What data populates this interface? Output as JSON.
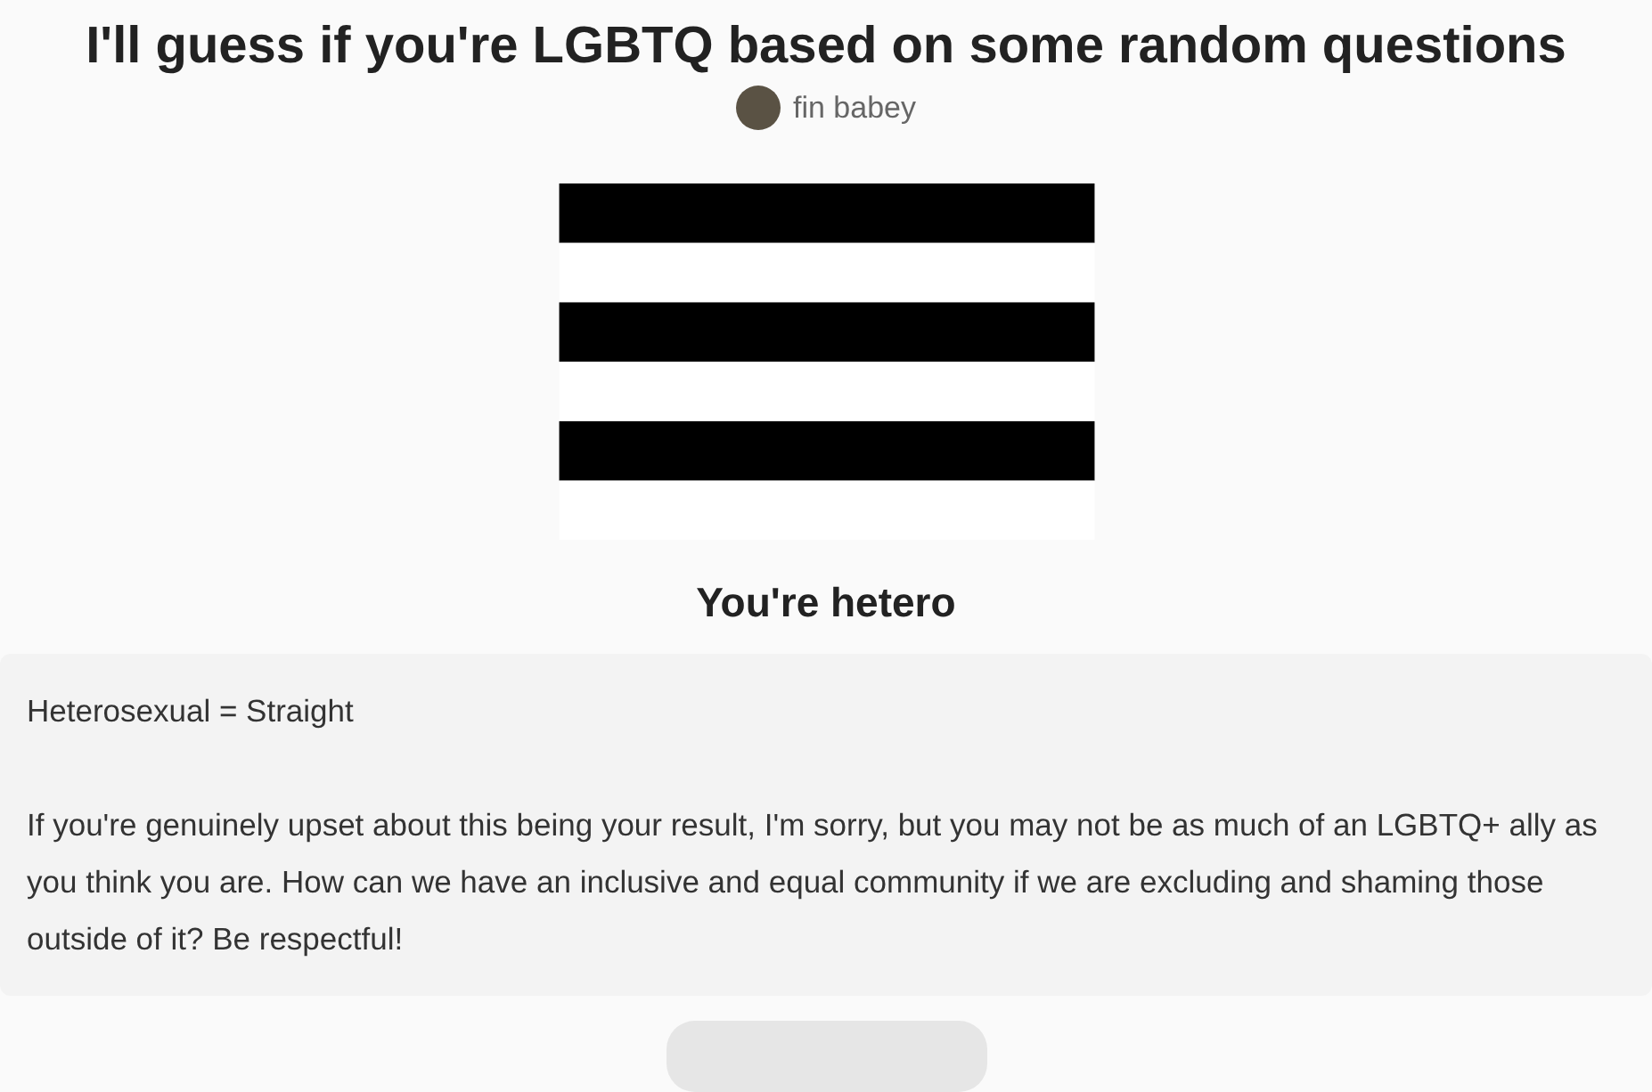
{
  "quiz": {
    "title": "I'll guess if you're LGBTQ based on some random questions",
    "author": "fin babey"
  },
  "result": {
    "heading": "You're hetero",
    "paragraphs": [
      "Heterosexual = Straight",
      "If you're genuinely upset about this being your result, I'm sorry, but you may not be as much of an LGBTQ+ ally as you think you are. How can we have an inclusive and equal community if we are excluding and shaming those outside of it? Be respectful!"
    ]
  }
}
